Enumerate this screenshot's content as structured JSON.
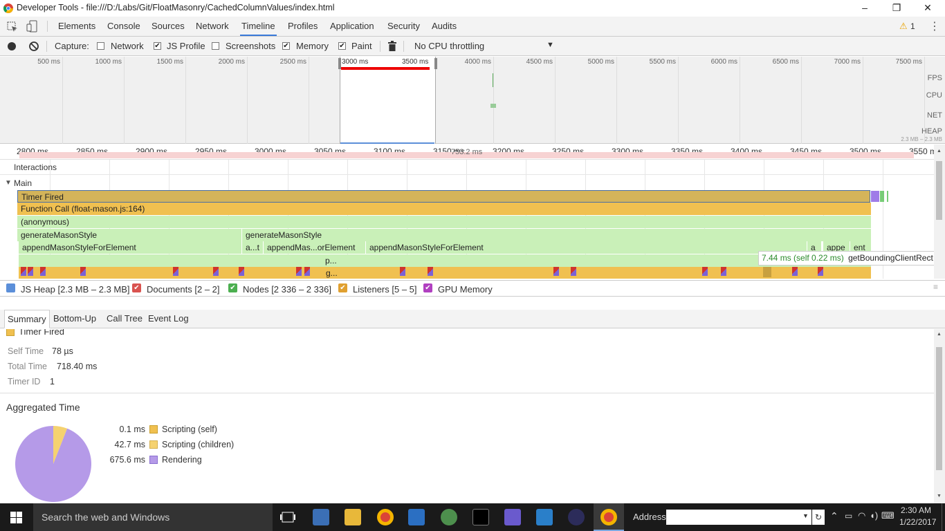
{
  "window": {
    "title": "Developer Tools - file:///D:/Labs/Git/FloatMasonry/CachedColumnValues/index.html"
  },
  "devtools_tabs": [
    "Elements",
    "Console",
    "Sources",
    "Network",
    "Timeline",
    "Profiles",
    "Application",
    "Security",
    "Audits"
  ],
  "selected_tab": "Timeline",
  "warning_count": "1",
  "toolbar": {
    "capture_label": "Capture:",
    "options": [
      {
        "label": "Network",
        "checked": false
      },
      {
        "label": "JS Profile",
        "checked": true
      },
      {
        "label": "Screenshots",
        "checked": false
      },
      {
        "label": "Memory",
        "checked": true
      },
      {
        "label": "Paint",
        "checked": true
      }
    ],
    "throttling": "No CPU throttling"
  },
  "overview": {
    "ticks": [
      "500 ms",
      "1000 ms",
      "1500 ms",
      "2000 ms",
      "2500 ms",
      "3000 ms",
      "3500 ms",
      "4000 ms",
      "4500 ms",
      "5000 ms",
      "5500 ms",
      "6000 ms",
      "6500 ms",
      "7000 ms",
      "7500 ms"
    ],
    "labels": [
      "FPS",
      "CPU",
      "NET",
      "HEAP"
    ],
    "heap_range": "2.3 MB – 2.3 MB"
  },
  "ruler": {
    "ticks": [
      "2800 ms",
      "2850 ms",
      "2900 ms",
      "2950 ms",
      "3000 ms",
      "3050 ms",
      "3100 ms",
      "3150 ms",
      "3200 ms",
      "3250 ms",
      "3300 ms",
      "3350 ms",
      "3400 ms",
      "3450 ms",
      "3500 ms",
      "3550 m"
    ],
    "selection_duration": "753.2 ms"
  },
  "tracks": {
    "interactions": "Interactions",
    "main": "Main"
  },
  "flame": {
    "timer_fired": "Timer Fired",
    "function_call": "Function Call (float-mason.js:164)",
    "anonymous": "(anonymous)",
    "gen1": "generateMasonStyle",
    "gen2": "generateMasonStyle",
    "append1": "appendMasonStyleForElement",
    "at": "a...t",
    "append2": "appendMas...orElement",
    "append3": "appendMasonStyleForElement",
    "a": "a",
    "appe": "appe",
    "ent": "ent",
    "p": "p...",
    "g": "g...",
    "tooltip_time": "7.44 ms (self 0.22 ms)",
    "tooltip_name": "getBoundingClientRect"
  },
  "counters": [
    {
      "label": "JS Heap [2.3 MB – 2.3 MB]",
      "color": "#5b8fd9",
      "checked": false
    },
    {
      "label": "Documents [2 – 2]",
      "color": "#d9534f",
      "checked": true
    },
    {
      "label": "Nodes [2 336 – 2 336]",
      "color": "#4caf50",
      "checked": true
    },
    {
      "label": "Listeners [5 – 5]",
      "color": "#e0a030",
      "checked": true
    },
    {
      "label": "GPU Memory",
      "color": "#b040c0",
      "checked": true
    }
  ],
  "detail_tabs": [
    "Summary",
    "Bottom-Up",
    "Call Tree",
    "Event Log"
  ],
  "summary": {
    "event": "Timer Fired",
    "self_time_label": "Self Time",
    "self_time": "78 µs",
    "total_time_label": "Total Time",
    "total_time": "718.40 ms",
    "timer_id_label": "Timer ID",
    "timer_id": "1",
    "aggregated_title": "Aggregated Time",
    "aggregated": [
      {
        "value": "0.1 ms",
        "label": "Scripting (self)",
        "color": "#f0c050",
        "ms": 0.1
      },
      {
        "value": "42.7 ms",
        "label": "Scripting (children)",
        "color": "#f5d270",
        "ms": 42.7
      },
      {
        "value": "675.6 ms",
        "label": "Rendering",
        "color": "#b59ae8",
        "ms": 675.6
      }
    ]
  },
  "taskbar": {
    "search_placeholder": "Search the web and Windows",
    "address_label": "Address",
    "time": "2:30 AM",
    "date": "1/22/2017"
  }
}
